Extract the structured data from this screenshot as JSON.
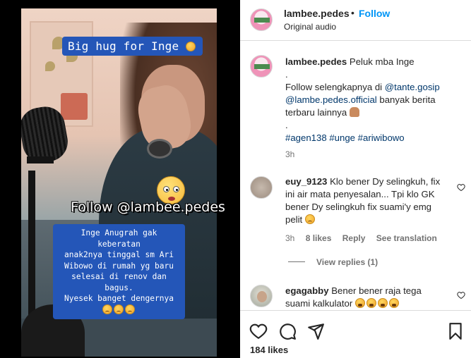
{
  "video": {
    "top_caption": "Big hug for Inge",
    "follow_overlay": "Follow @lambee.pedes",
    "caption_lines": [
      "Inge Anugrah gak keberatan",
      "anak2nya tinggal sm Ari",
      "Wibowo di rumah yg baru",
      "selesai di renov dan bagus.",
      "Nyesek banget dengernya"
    ]
  },
  "header": {
    "username": "lambee.pedes",
    "separator": "•",
    "follow_label": "Follow",
    "audio": "Original audio"
  },
  "post_caption": {
    "username": "lambee.pedes",
    "text": "Peluk mba Inge",
    "dot1": ".",
    "line_follow": "Follow selengkapnya di",
    "mention1": "@tante.gosip",
    "mention2": "@lambe.pedes.official",
    "line_rest": "banyak berita",
    "line_rest2": "terbaru lainnya",
    "dot2": ".",
    "hashtags": "#agen138 #unge #ariwibowo",
    "time": "3h"
  },
  "comments": [
    {
      "username": "euy_9123",
      "text_line1": "Klo bener Dy selingkuh, fix",
      "text_line2": "ini air mata penyesalan... Tpi klo GK",
      "text_line3": "bener Dy selingkuh fix suami'y emg",
      "text_line4": "pelit",
      "time": "3h",
      "likes": "8 likes",
      "reply": "Reply",
      "translate": "See translation",
      "view_replies": "View replies (1)"
    },
    {
      "username": "egagabby",
      "text_line1": "Bener bener raja tega",
      "text_line2": "suami kalkulator"
    }
  ],
  "actions": {
    "likes": "184 likes"
  },
  "colors": {
    "accent": "#0095f6",
    "caption_bg": "#2456b8",
    "link": "#00376b"
  }
}
